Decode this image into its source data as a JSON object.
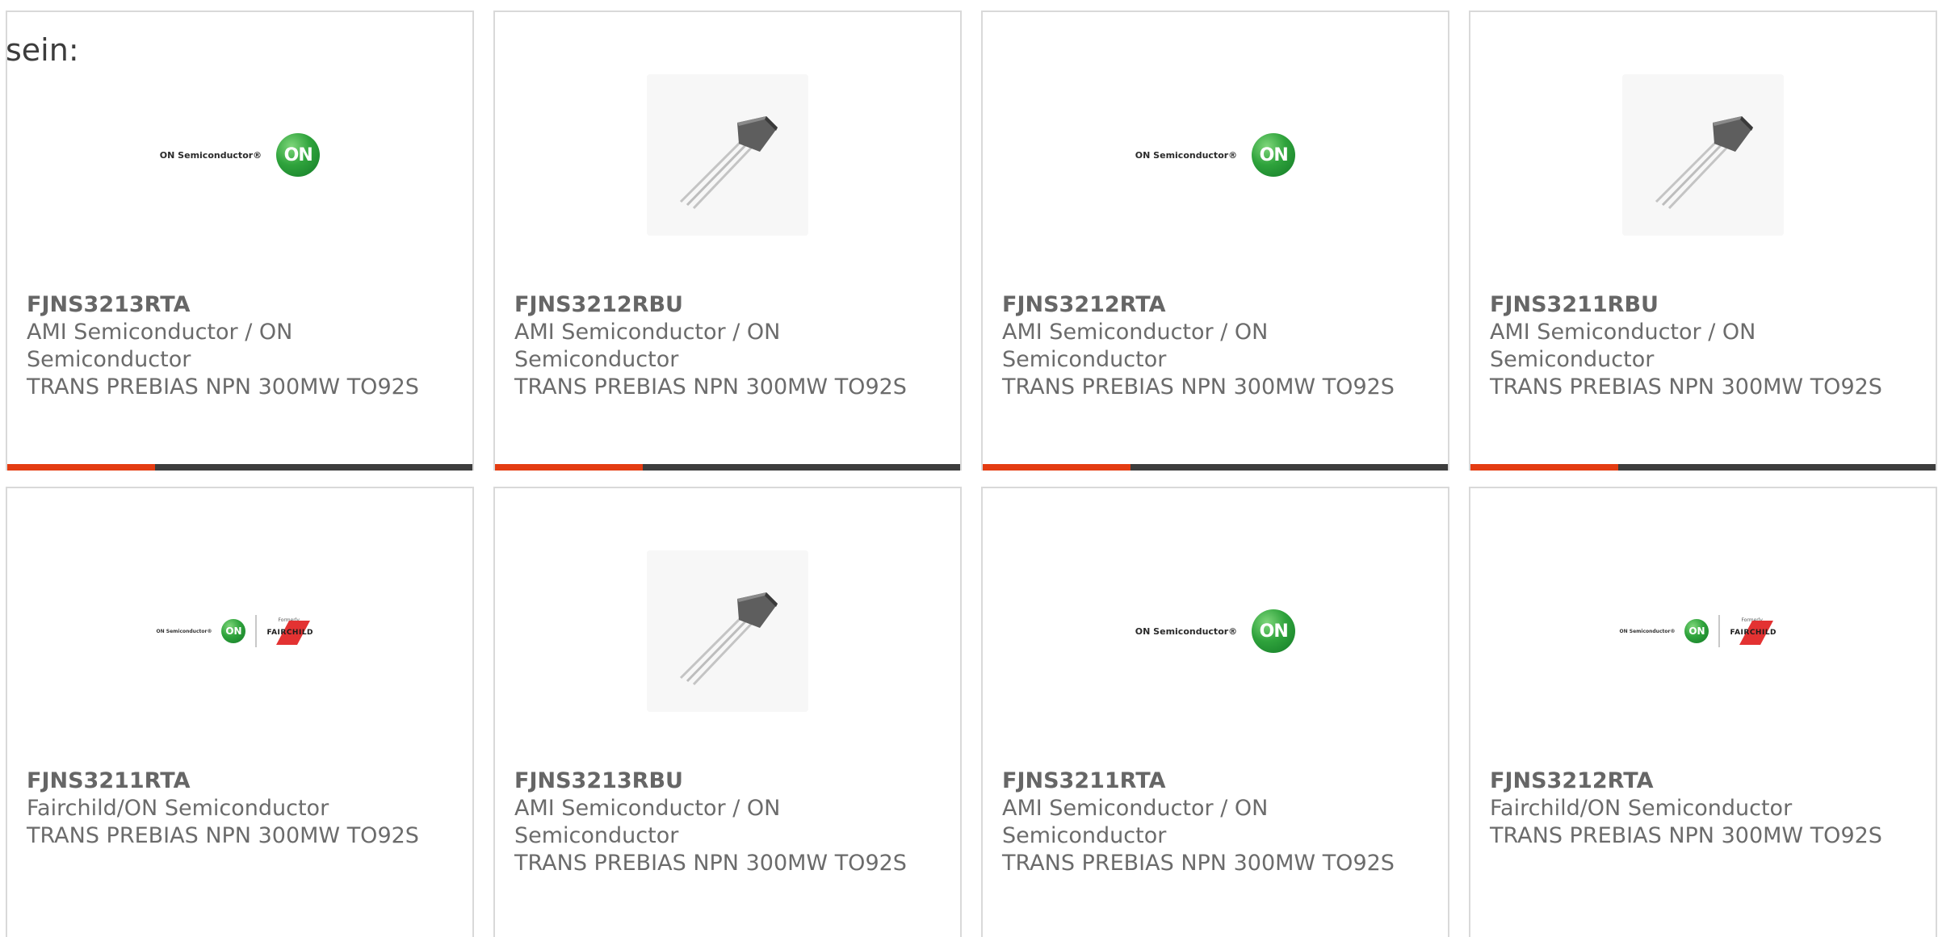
{
  "intro_text": "sein:",
  "products": [
    {
      "part": "FJNS3213RTA",
      "manufacturer": "AMI Semiconductor / ON Semiconductor",
      "description": "TRANS PREBIAS NPN 300MW TO92S",
      "image": "on-semiconductor-logo"
    },
    {
      "part": "FJNS3212RBU",
      "manufacturer": "AMI Semiconductor / ON Semiconductor",
      "description": "TRANS PREBIAS NPN 300MW TO92S",
      "image": "to92-transistor-photo"
    },
    {
      "part": "FJNS3212RTA",
      "manufacturer": "AMI Semiconductor / ON Semiconductor",
      "description": "TRANS PREBIAS NPN 300MW TO92S",
      "image": "on-semiconductor-logo"
    },
    {
      "part": "FJNS3211RBU",
      "manufacturer": "AMI Semiconductor / ON Semiconductor",
      "description": "TRANS PREBIAS NPN 300MW TO92S",
      "image": "to92-transistor-photo"
    },
    {
      "part": "FJNS3211RTA",
      "manufacturer": "Fairchild/ON Semiconductor",
      "description": "TRANS PREBIAS NPN 300MW TO92S",
      "image": "on-fairchild-logo"
    },
    {
      "part": "FJNS3213RBU",
      "manufacturer": "AMI Semiconductor / ON Semiconductor",
      "description": "TRANS PREBIAS NPN 300MW TO92S",
      "image": "to92-transistor-photo"
    },
    {
      "part": "FJNS3211RTA",
      "manufacturer": "AMI Semiconductor / ON Semiconductor",
      "description": "TRANS PREBIAS NPN 300MW TO92S",
      "image": "on-semiconductor-logo"
    },
    {
      "part": "FJNS3212RTA",
      "manufacturer": "Fairchild/ON Semiconductor",
      "description": "TRANS PREBIAS NPN 300MW TO92S",
      "image": "on-fairchild-logo"
    }
  ],
  "logos": {
    "on_wordmark": "ON Semiconductor®",
    "on_ball": "ON",
    "fairchild_formerly": "Formerly",
    "fairchild_wordmark": "FAIRCHILD"
  },
  "colors": {
    "accent": "#e43c12",
    "bar": "#3d3d3d",
    "card_border": "#d9d9d9",
    "on_green": "#2fa33c",
    "fairchild_red": "#e33232"
  }
}
